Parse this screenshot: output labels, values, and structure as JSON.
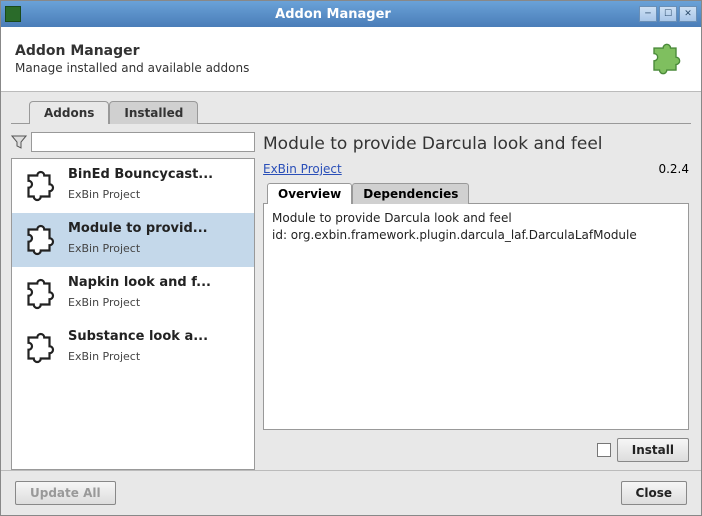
{
  "window": {
    "title": "Addon Manager"
  },
  "header": {
    "title": "Addon Manager",
    "subtitle": "Manage installed and available addons"
  },
  "tabs": {
    "addons": "Addons",
    "installed": "Installed"
  },
  "filter": {
    "placeholder": ""
  },
  "list": [
    {
      "title": "BinEd Bouncycast...",
      "sub": "ExBin Project"
    },
    {
      "title": "Module to provid...",
      "sub": "ExBin Project"
    },
    {
      "title": "Napkin look and f...",
      "sub": "ExBin Project"
    },
    {
      "title": "Substance look a...",
      "sub": "ExBin Project"
    }
  ],
  "detail": {
    "title": "Module to provide Darcula look and feel",
    "project": "ExBin Project",
    "version": "0.2.4",
    "tabs": {
      "overview": "Overview",
      "dependencies": "Dependencies"
    },
    "overview_line1": "Module to provide Darcula look and feel",
    "overview_line2": "id: org.exbin.framework.plugin.darcula_laf.DarculaLafModule"
  },
  "buttons": {
    "install": "Install",
    "update_all": "Update All",
    "close": "Close"
  }
}
